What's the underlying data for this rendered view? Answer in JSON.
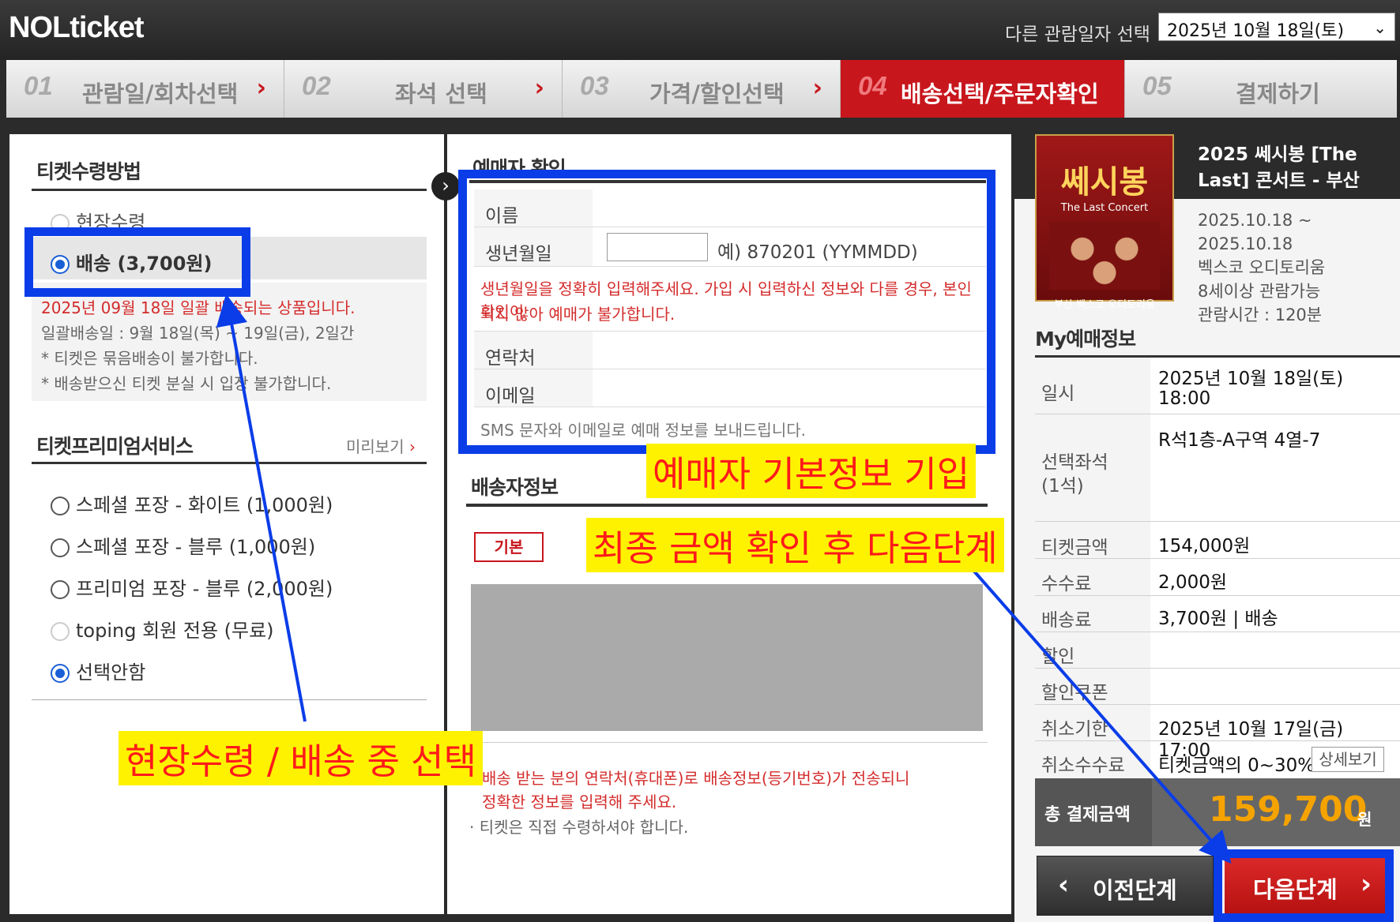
{
  "header": {
    "logo": "NOLticket",
    "date_label": "다른 관람일자 선택",
    "date_value": "2025년 10월 18일(토)"
  },
  "steps": [
    {
      "num": "01",
      "label": "관람일/회차선택"
    },
    {
      "num": "02",
      "label": "좌석 선택"
    },
    {
      "num": "03",
      "label": "가격/할인선택"
    },
    {
      "num": "04",
      "label": "배송선택/주문자확인"
    },
    {
      "num": "05",
      "label": "결제하기"
    }
  ],
  "left": {
    "title": "티켓수령방법",
    "opt_onsite": "현장수령",
    "opt_delivery": "배송 (3,700원)",
    "notice_red": "2025년 09월 18일 일괄 배송되는 상품입니다.",
    "notice1": "일괄배송일 : 9월 18일(목) ~ 19일(금), 2일간",
    "notice2": "* 티켓은 묶음배송이 불가합니다.",
    "notice3": "* 배송받으신 티켓 분실 시 입장 불가합니다.",
    "premium_title": "티켓프리미엄서비스",
    "preview": "미리보기",
    "premium": [
      "스페셜 포장 - 화이트 (1,000원)",
      "스페셜 포장 - 블루 (1,000원)",
      "프리미엄 포장 - 블루 (2,000원)",
      "toping 회원 전용 (무료)",
      "선택안함"
    ]
  },
  "middle": {
    "title": "예매자 확인",
    "name_label": "이름",
    "birth_label": "생년월일",
    "birth_hint": "예) 870201 (YYMMDD)",
    "birth_warn1": "생년월일을 정확히 입력해주세요. 가입 시 입력하신 정보와 다를 경우, 본인확인이",
    "birth_warn2": "되지 않아 예매가 불가합니다.",
    "phone_label": "연락처",
    "email_label": "이메일",
    "sms_note": "SMS 문자와 이메일로 예매 정보를 보내드립니다.",
    "ship_title": "배송자정보",
    "ship_tag": "기본",
    "ship_note1": "배송 받는 분의 연락처(휴대폰)로 배송정보(등기번호)가 전송되니",
    "ship_note2": "정확한 정보를 입력해 주세요.",
    "ship_note3": "· 티켓은 직접 수령하셔야 합니다."
  },
  "show": {
    "poster_title": "쎄시봉",
    "poster_sub": "The Last Concert",
    "poster_venue": "부산 벡스코 오디토리움",
    "title": "2025 쎄시봉 [The Last] 콘서트 - 부산",
    "period1": "2025.10.18 ~",
    "period2": "2025.10.18",
    "venue": "벡스코 오디토리움",
    "age": "8세이상 관람가능",
    "runtime": "관람시간 : 120분"
  },
  "myinfo": {
    "title": "My예매정보",
    "date_k": "일시",
    "date_v1": "2025년 10월 18일(토)",
    "date_v2": "18:00",
    "seat_k1": "선택좌석",
    "seat_k2": "(1석)",
    "seat_v": "R석1층-A구역 4열-7",
    "price_k": "티켓금액",
    "price_v": "154,000원",
    "fee_k": "수수료",
    "fee_v": "2,000원",
    "ship_k": "배송료",
    "ship_v": "3,700원 | 배송",
    "disc_k": "할인",
    "coupon_k": "할인쿠폰",
    "cancel_k": "취소기한",
    "cancel_v": "2025년 10월 17일(금) 17:00",
    "cfee_k": "취소수수료",
    "cfee_v": "티켓금액의 0~30%",
    "detail": "상세보기",
    "total_k": "총 결제금액",
    "total_v": "159,700",
    "total_unit": "원"
  },
  "buttons": {
    "prev": "이전단계",
    "next": "다음단계"
  },
  "annotations": {
    "a1": "현장수령 / 배송 중 선택",
    "a2": "예매자 기본정보 기입",
    "a3": "최종 금액 확인 후 다음단계"
  },
  "colors": {
    "brand_red": "#c8161d",
    "annotation_blue": "#0a3de8",
    "annotation_yellow": "#fff200",
    "price_orange": "#f5a300"
  }
}
